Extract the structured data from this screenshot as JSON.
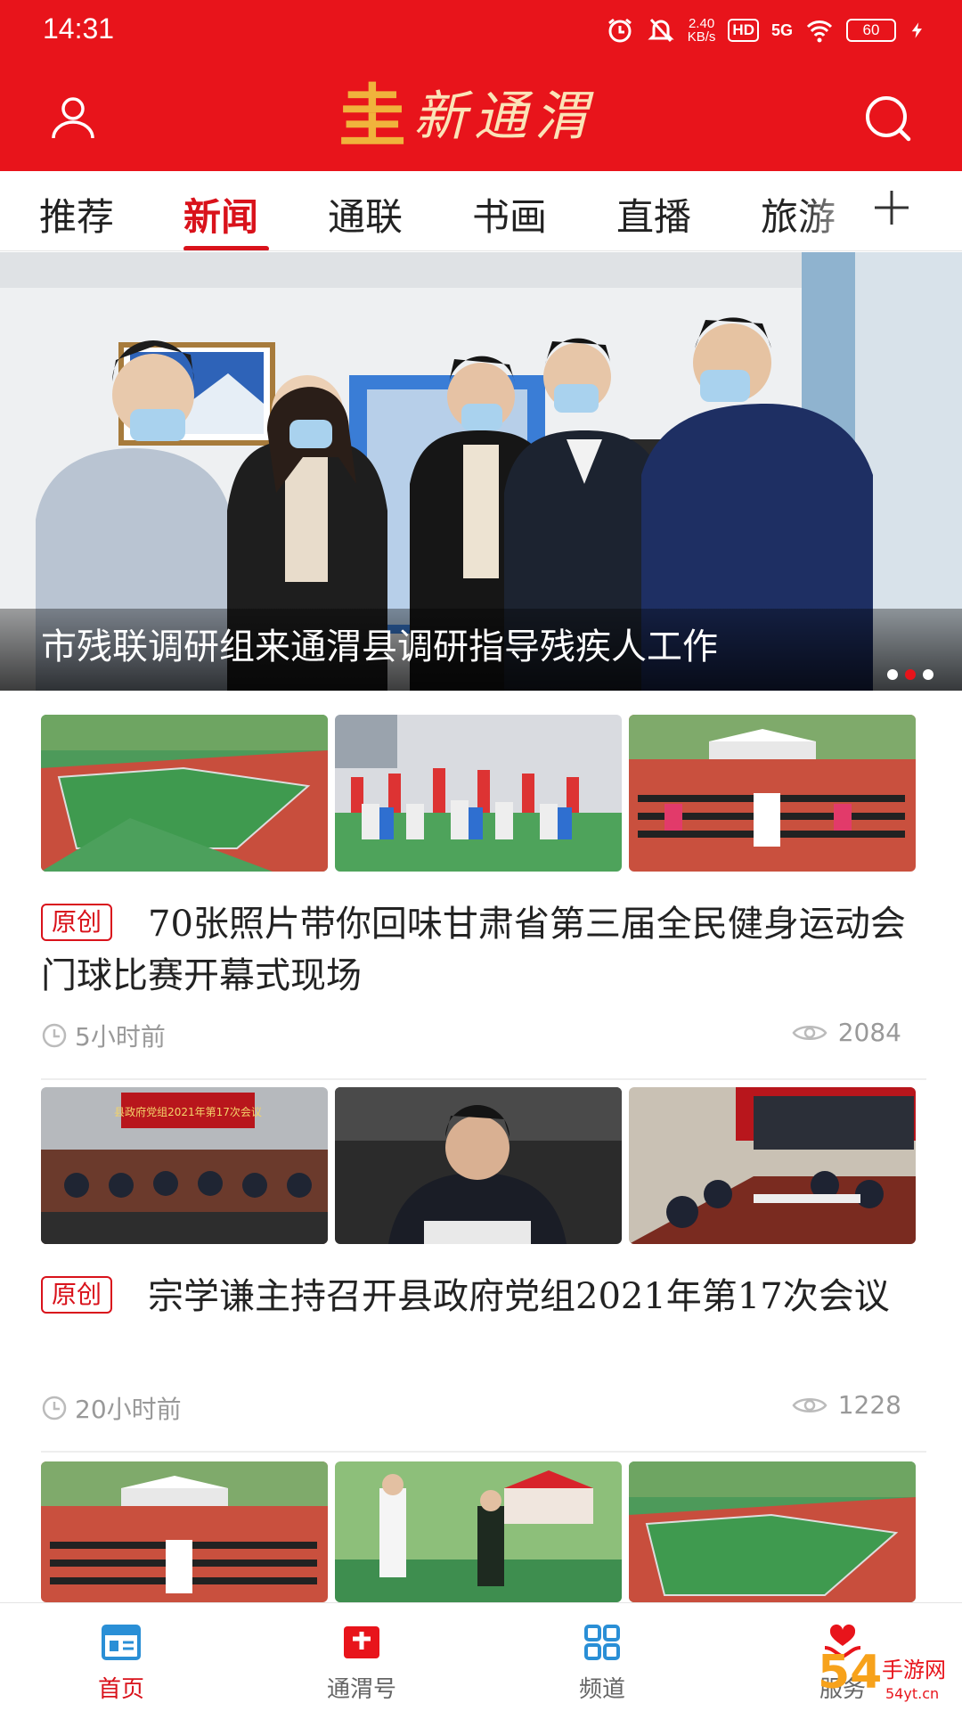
{
  "status_bar": {
    "time": "14:31",
    "speed_value": "2.40",
    "speed_unit": "KB/s",
    "hd": "HD",
    "network": "5G",
    "battery": "60"
  },
  "header": {
    "logo_mark": "圭",
    "logo_text": "新通渭",
    "user_icon": "user-icon",
    "search_icon": "search-icon",
    "brand_color": "#e8141b"
  },
  "tabs": [
    {
      "label": "推荐"
    },
    {
      "label": "新闻"
    },
    {
      "label": "通联"
    },
    {
      "label": "书画"
    },
    {
      "label": "直播"
    },
    {
      "label": "旅游"
    }
  ],
  "active_tab": "新闻",
  "hero": {
    "caption": "市残联调研组来通渭县调研指导残疾人工作",
    "slide_index": 2,
    "slide_count": 3
  },
  "news": [
    {
      "tag": "原创",
      "title": "70张照片带你回味甘肃省第三届全民健身运动会门球比赛开幕式现场",
      "time": "5小时前",
      "views": "2084"
    },
    {
      "tag": "原创",
      "title": "宗学谦主持召开县政府党组2021年第17次会议",
      "time": "20小时前",
      "views": "1228"
    }
  ],
  "meeting_banner": "县政府党组2021年第17次会议",
  "bottom_nav": [
    {
      "label": "首页",
      "icon": "home-news-icon"
    },
    {
      "label": "通渭号",
      "icon": "plus-square-icon"
    },
    {
      "label": "频道",
      "icon": "grid-icon"
    },
    {
      "label": "服务",
      "icon": "heart-hands-icon"
    }
  ],
  "watermark": {
    "brand": "54",
    "site": "手游网",
    "domain": "54yt.cn"
  }
}
